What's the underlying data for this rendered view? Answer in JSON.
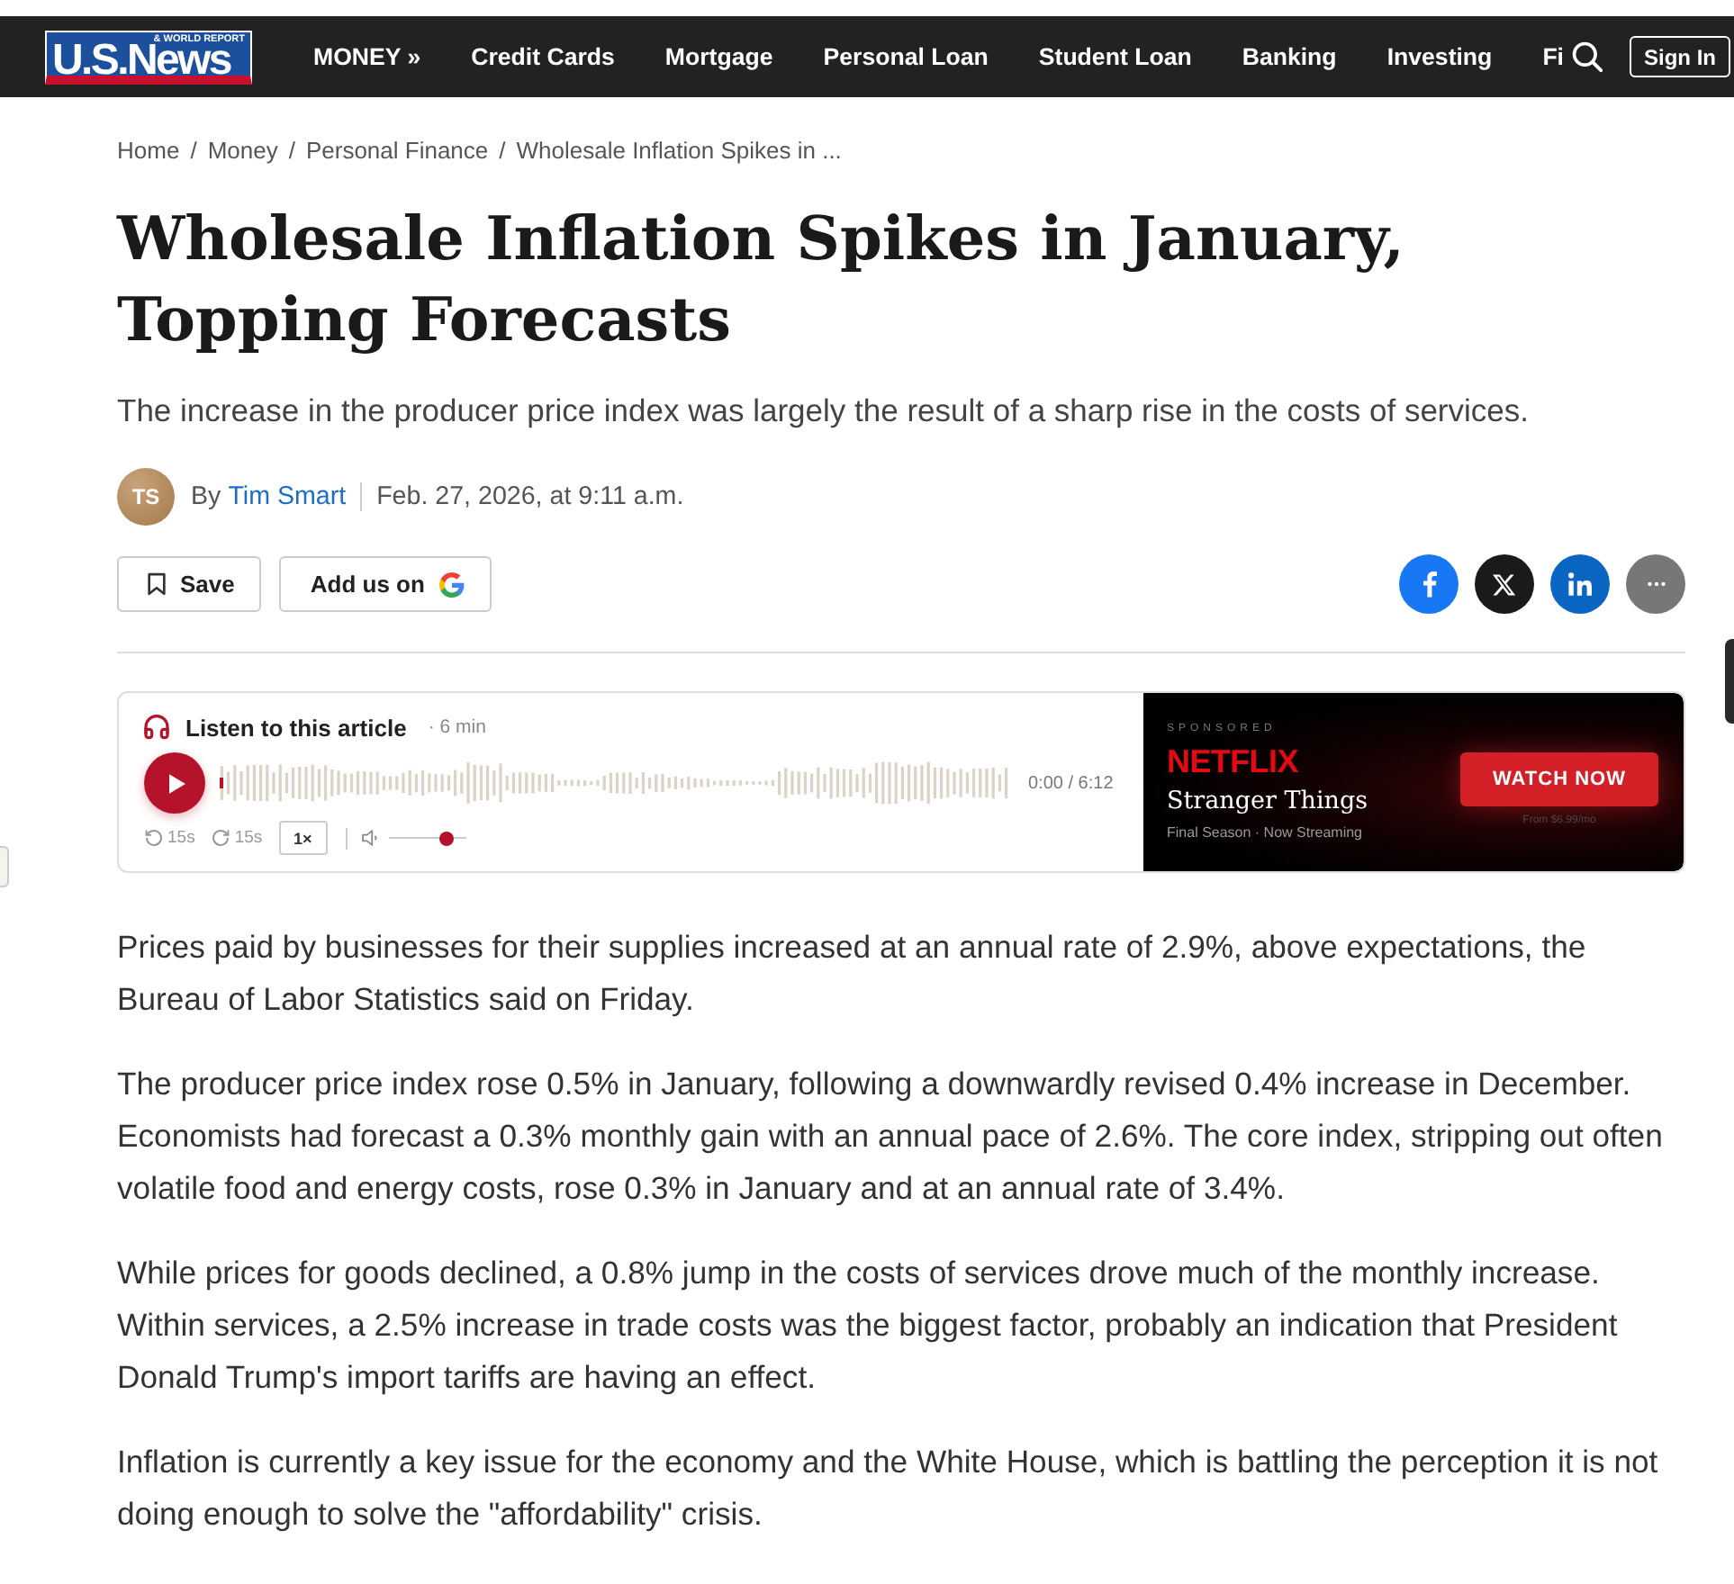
{
  "header": {
    "logo": {
      "tagline": "& WORLD REPORT",
      "wordmark": "U.S.News"
    },
    "nav": [
      "MONEY »",
      "Credit Cards",
      "Mortgage",
      "Personal Loan",
      "Student Loan",
      "Banking",
      "Investing",
      "Fi"
    ],
    "sign_in": "Sign In"
  },
  "breadcrumbs": {
    "separator": "/",
    "items": [
      "Home",
      "Money",
      "Personal Finance",
      "Wholesale Inflation Spikes in ..."
    ]
  },
  "article": {
    "title": "Wholesale Inflation Spikes in January, Topping Forecasts",
    "subtitle": "The increase in the producer price index was largely the result of a sharp rise in the costs of services.",
    "byline": {
      "initials": "TS",
      "prefix": "By",
      "author": "Tim Smart",
      "date": "Feb. 27, 2026, at 9:11 a.m."
    },
    "actions": [
      {
        "kind": "save",
        "label": "Save"
      },
      {
        "kind": "google",
        "label": "Add us on"
      }
    ],
    "share": [
      {
        "kind": "facebook"
      },
      {
        "kind": "x"
      },
      {
        "kind": "linkedin"
      },
      {
        "kind": "more"
      }
    ]
  },
  "audio_player": {
    "heading": "Listen to this article",
    "duration": "· 6 min",
    "playing": false,
    "progress": {
      "level": 0
    },
    "time": "0:00 / 6:12",
    "skip_back": "15s",
    "skip_forward": "15s",
    "speed": "1×",
    "volume": {
      "level": 0.75
    }
  },
  "ad": {
    "label": "SPONSORED",
    "brand": "NETFLIX",
    "title": "Stranger Things",
    "subtitle": "Final Season · Now Streaming",
    "button": "WATCH NOW",
    "price_note": "From $6.99/mo"
  },
  "paragraphs": [
    "Prices paid by businesses for their supplies increased at an annual rate of 2.9%, above expectations, the Bureau of Labor Statistics said on Friday.",
    "The producer price index rose 0.5% in January, following a downwardly revised 0.4% increase in December. Economists had forecast a 0.3% monthly gain with an annual pace of 2.6%. The core index, stripping out often volatile food and energy costs, rose 0.3% in January and at an annual rate of 3.4%.",
    "While prices for goods declined, a 0.8% jump in the costs of services drove much of the monthly increase. Within services, a 2.5% increase in trade costs was the biggest factor, probably an indication that President Donald Trump's import tariffs are having an effect.",
    "Inflation is currently a key issue for the economy and the White House, which is battling the perception it is not doing enough to solve the \"affordability\" crisis."
  ]
}
